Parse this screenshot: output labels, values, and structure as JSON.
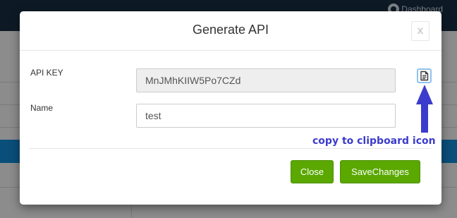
{
  "background": {
    "dashboard_label": "Dashboard"
  },
  "modal": {
    "title": "Generate API",
    "close_label": "x",
    "api_key": {
      "label": "API KEY",
      "value": "MnJMhKIIW5Po7CZd"
    },
    "name": {
      "label": "Name",
      "value": "test"
    },
    "buttons": {
      "close": "Close",
      "save": "SaveChanges"
    }
  },
  "annotation": {
    "text": "copy to clipboard icon"
  },
  "colors": {
    "primary_button": "#5aa800",
    "annotation": "#3c3ccc",
    "topbar": "#0d1a26"
  },
  "icons": [
    "gauge-icon",
    "clipboard-copy-icon",
    "arrow-up-icon"
  ]
}
